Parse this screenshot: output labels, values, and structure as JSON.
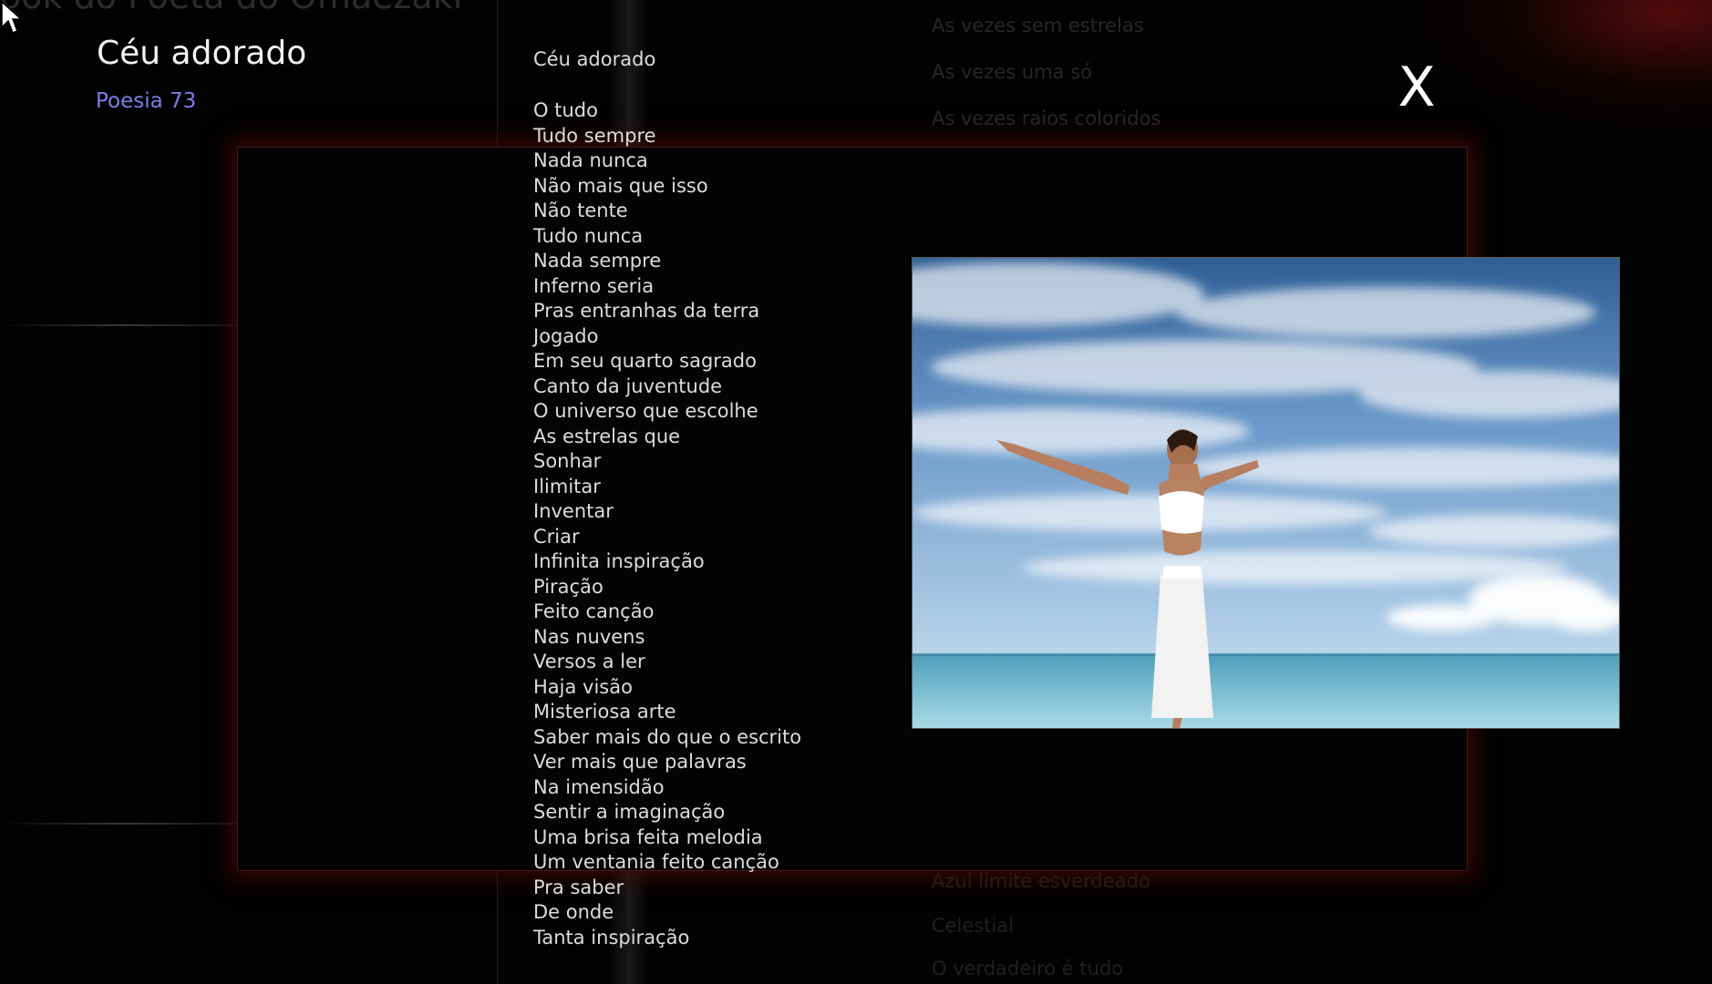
{
  "background": {
    "title": "ook do Poeta do Omaezaki",
    "top_lines": [
      "As vezes sem estrelas",
      "As vezes uma só",
      "As vezes raios coloridos"
    ],
    "bottom_lines": [
      "Azul limite esverdeado",
      "Celestial",
      "O verdadeiro é tudo"
    ]
  },
  "poem": {
    "title": "Céu adorado",
    "subtitle": "Poesia 73",
    "heading": "Céu adorado",
    "lines": [
      "O tudo",
      "Tudo sempre",
      "Nada nunca",
      "Não mais que isso",
      "Não tente",
      "Tudo nunca",
      "Nada sempre",
      "Inferno seria",
      "Pras entranhas da terra",
      "Jogado",
      "Em seu quarto sagrado",
      "Canto da juventude",
      "O universo que escolhe",
      "As estrelas que",
      "Sonhar",
      "Ilimitar",
      "Inventar",
      "Criar",
      "Infinita inspiração",
      "Piração",
      "Feito canção",
      "Nas nuvens",
      "Versos a ler",
      "Haja visão",
      "Misteriosa arte",
      "Saber mais do que o escrito",
      "Ver mais que palavras",
      "Na imensidão",
      "Sentir a imaginação",
      "Uma brisa feita melodia",
      "Um ventania feito canção",
      "Pra saber",
      "De onde",
      "Tanta inspiração"
    ]
  },
  "controls": {
    "close_label": "X"
  },
  "icons": {
    "cursor": "mouse-pointer-icon",
    "close": "close-icon"
  },
  "colors": {
    "subtitle": "#7d7de6",
    "panel_glow": "#5f0a0a"
  }
}
